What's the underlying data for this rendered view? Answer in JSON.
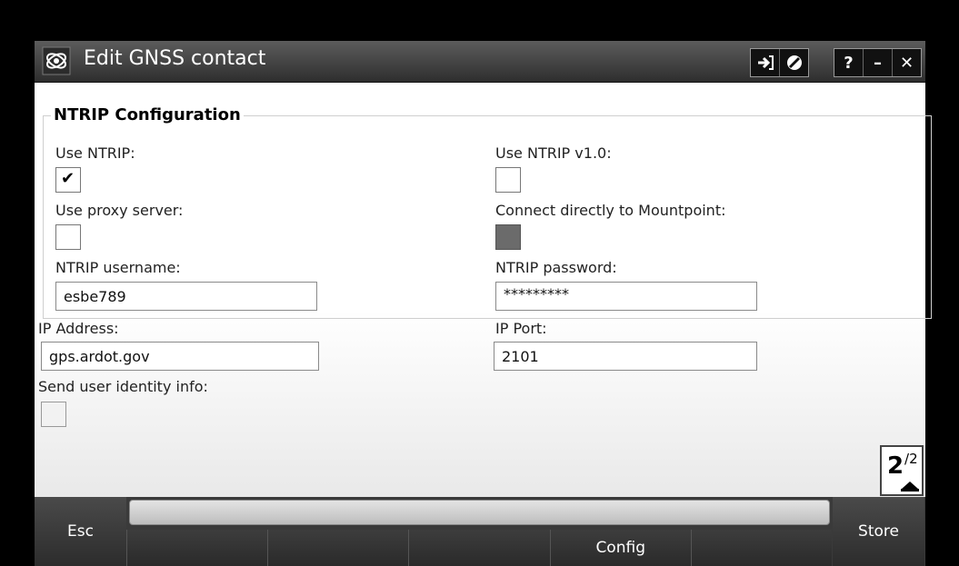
{
  "window": {
    "title": "Edit GNSS contact"
  },
  "titlebar_buttons": {
    "group1": [
      "login-icon",
      "no-entry-icon"
    ],
    "help": "?",
    "minimize": "–",
    "close": "✕"
  },
  "section": {
    "title": "NTRIP Configuration"
  },
  "fields": {
    "use_ntrip": {
      "label": "Use NTRIP:",
      "checked": true
    },
    "use_ntrip_v1": {
      "label": "Use NTRIP v1.0:",
      "checked": false
    },
    "use_proxy": {
      "label": "Use proxy server:",
      "checked": false
    },
    "connect_mountpoint": {
      "label": "Connect directly to Mountpoint:",
      "checked": false,
      "disabled": true
    },
    "username": {
      "label": "NTRIP username:",
      "value": "esbe789"
    },
    "password": {
      "label": "NTRIP password:",
      "value": "*********"
    },
    "ip_address": {
      "label": "IP Address:",
      "value": "gps.ardot.gov"
    },
    "ip_port": {
      "label": "IP Port:",
      "value": "2101"
    },
    "send_identity": {
      "label": "Send user identity info:",
      "checked": false
    }
  },
  "pager": {
    "current": "2",
    "total": "2"
  },
  "softkeys": {
    "left": "Esc",
    "right": "Store",
    "fkeys": [
      "",
      "",
      "",
      "Config",
      "",
      ""
    ]
  },
  "colors": {
    "titlebar": "#3a3a3a",
    "background": "#ffffff",
    "bottombar": "#2e2e2e"
  }
}
